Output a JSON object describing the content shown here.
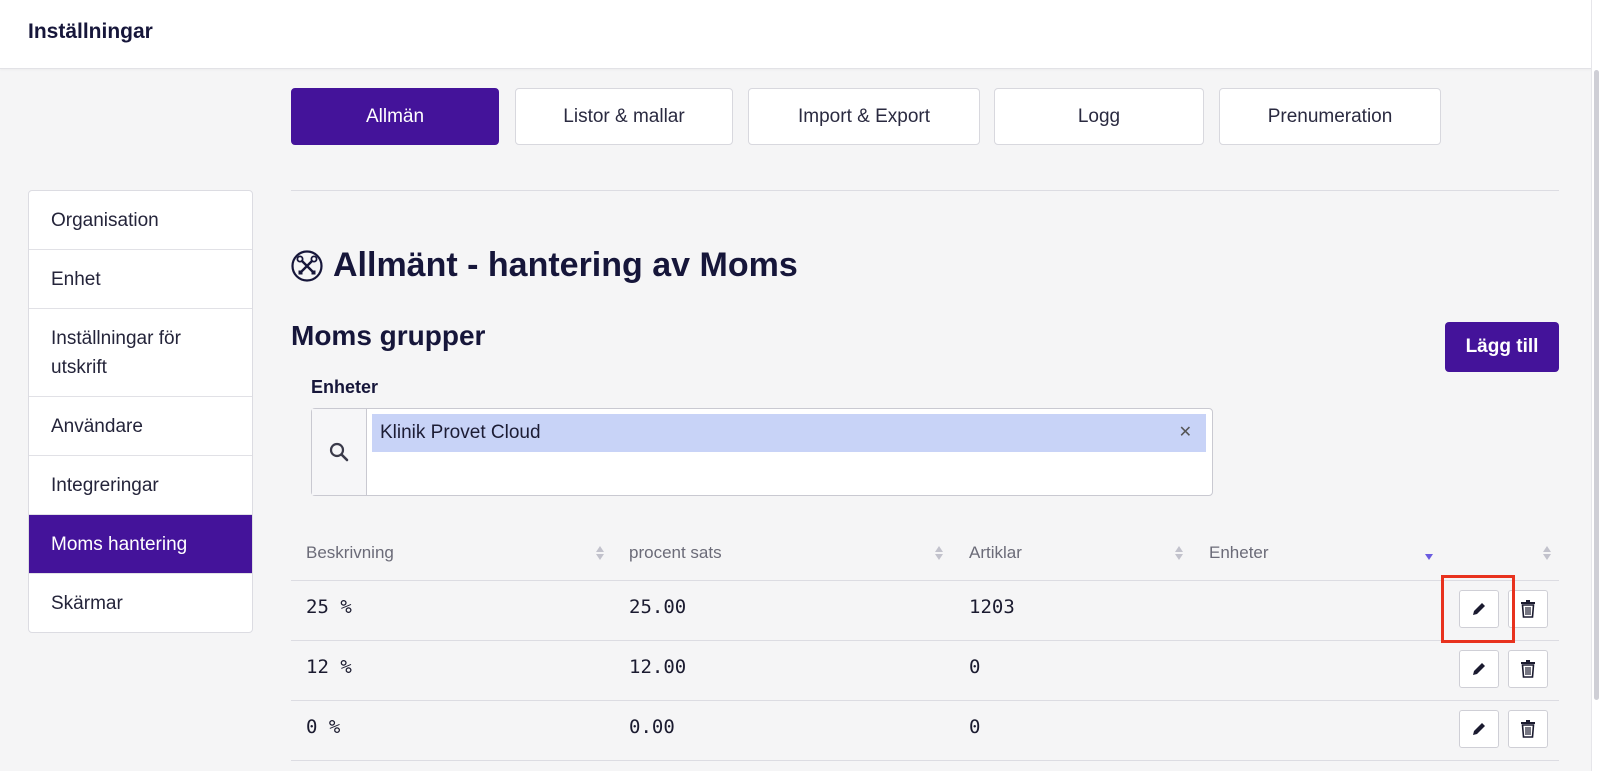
{
  "header": {
    "title": "Inställningar"
  },
  "tabs": [
    {
      "label": "Allmän",
      "active": true
    },
    {
      "label": "Listor & mallar"
    },
    {
      "label": "Import & Export"
    },
    {
      "label": "Logg"
    },
    {
      "label": "Prenumeration"
    }
  ],
  "sidebar": {
    "items": [
      {
        "label": "Organisation"
      },
      {
        "label": "Enhet"
      },
      {
        "label": "Inställningar för utskrift"
      },
      {
        "label": "Användare"
      },
      {
        "label": "Integreringar"
      },
      {
        "label": "Moms hantering",
        "active": true
      },
      {
        "label": "Skärmar"
      }
    ]
  },
  "main": {
    "title": "Allmänt - hantering av Moms",
    "title_icon": "tools-icon",
    "section_title": "Moms grupper",
    "add_button": "Lägg till",
    "units_label": "Enheter",
    "selected_unit": "Klinik Provet Cloud",
    "table": {
      "columns": [
        "Beskrivning",
        "procent sats",
        "Artiklar",
        "Enheter"
      ],
      "rows": [
        {
          "description": "25 %",
          "rate": "25.00",
          "articles": "1203",
          "units": ""
        },
        {
          "description": "12 %",
          "rate": "12.00",
          "articles": "0",
          "units": ""
        },
        {
          "description": "0 %",
          "rate": "0.00",
          "articles": "0",
          "units": ""
        }
      ]
    }
  },
  "colors": {
    "accent": "#44139a",
    "chip": "#c8d3f7",
    "highlight": "#e8321e"
  }
}
